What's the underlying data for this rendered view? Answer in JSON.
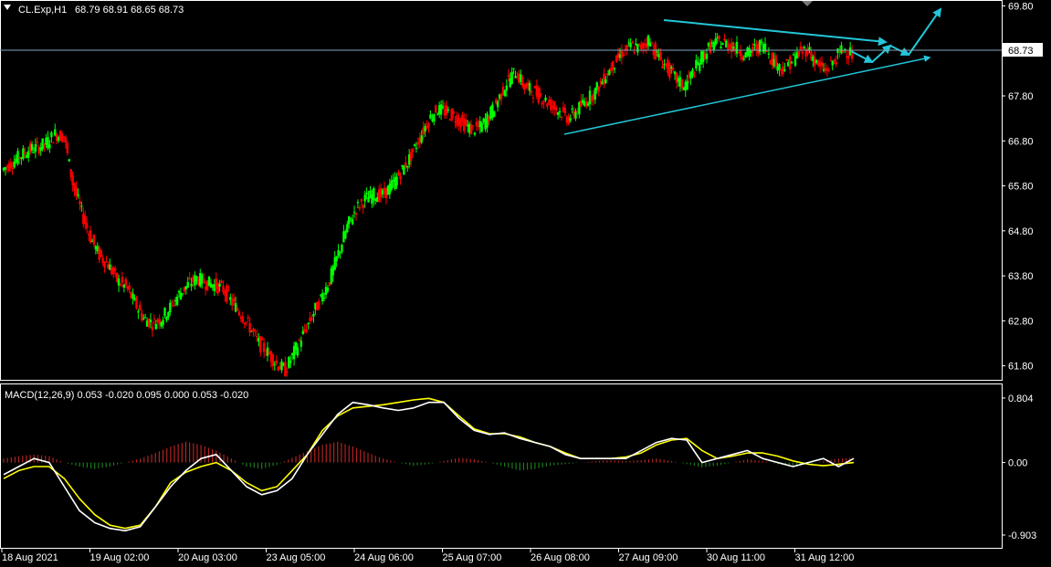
{
  "symbol_header": {
    "symbol": "CL.Exp,H1",
    "ohlc": "68.79 68.91 68.65 68.73"
  },
  "macd_header": "MACD(12,26,9) 0.053 -0.020 0.095 0.000 0.053 -0.020",
  "current_price": "68.73",
  "colors": {
    "background": "#000000",
    "bull": "#00ff00",
    "bear": "#ff0000",
    "trendline": "#22c7d9",
    "macd_line": "#ffffff",
    "signal_line": "#ffff00",
    "hist_pos": "#b22222",
    "hist_neg": "#1a7a1a",
    "grid_border": "#ffffff"
  },
  "chart_data": [
    {
      "type": "candlestick",
      "title": "CL.Exp,H1",
      "y_ticks": [
        "69.80",
        "68.73",
        "67.80",
        "66.80",
        "65.80",
        "64.80",
        "63.80",
        "62.80",
        "61.80"
      ],
      "ylim": [
        61.57,
        69.85
      ],
      "x_ticks": [
        "18 Aug 2021",
        "19 Aug 02:00",
        "20 Aug 03:00",
        "23 Aug 05:00",
        "24 Aug 06:00",
        "25 Aug 07:00",
        "26 Aug 08:00",
        "27 Aug 09:00",
        "30 Aug 11:00",
        "31 Aug 12:00"
      ],
      "closes": [
        66.15,
        66.3,
        66.45,
        66.6,
        66.65,
        66.75,
        66.95,
        66.9,
        65.85,
        65.2,
        64.65,
        64.25,
        64.05,
        63.7,
        63.55,
        63.2,
        62.85,
        62.75,
        62.85,
        63.1,
        63.4,
        63.6,
        63.75,
        63.65,
        63.6,
        63.5,
        63.2,
        62.95,
        62.65,
        62.3,
        62.1,
        61.85,
        61.7,
        62.1,
        62.5,
        62.9,
        63.3,
        63.7,
        64.3,
        64.9,
        65.3,
        65.5,
        65.6,
        65.6,
        65.8,
        66.1,
        66.4,
        66.8,
        67.2,
        67.5,
        67.45,
        67.35,
        67.2,
        67.05,
        67.1,
        67.35,
        67.7,
        68.1,
        68.35,
        68.0,
        67.9,
        67.75,
        67.6,
        67.45,
        67.3,
        67.5,
        67.7,
        67.9,
        68.2,
        68.5,
        68.75,
        68.9,
        68.85,
        69.05,
        68.7,
        68.45,
        68.2,
        68.0,
        68.3,
        68.65,
        68.9,
        69.0,
        68.95,
        68.85,
        68.7,
        68.85,
        68.95,
        68.6,
        68.4,
        68.55,
        68.75,
        68.85,
        68.5,
        68.35,
        68.6,
        68.85,
        68.73
      ],
      "opens": [
        66.05,
        66.15,
        66.3,
        66.45,
        66.6,
        66.65,
        66.75,
        66.95,
        66.9,
        65.85,
        65.2,
        64.65,
        64.25,
        64.05,
        63.7,
        63.55,
        63.2,
        62.85,
        62.75,
        62.85,
        63.1,
        63.4,
        63.6,
        63.75,
        63.65,
        63.6,
        63.5,
        63.2,
        62.95,
        62.65,
        62.3,
        62.1,
        61.85,
        61.7,
        62.1,
        62.5,
        62.9,
        63.3,
        63.7,
        64.3,
        64.9,
        65.3,
        65.5,
        65.6,
        65.6,
        65.8,
        66.1,
        66.4,
        66.8,
        67.2,
        67.5,
        67.45,
        67.35,
        67.2,
        67.05,
        67.1,
        67.35,
        67.7,
        68.1,
        68.35,
        68.0,
        67.9,
        67.75,
        67.6,
        67.45,
        67.3,
        67.5,
        67.7,
        67.9,
        68.2,
        68.5,
        68.75,
        68.9,
        68.85,
        69.05,
        68.7,
        68.45,
        68.2,
        68.0,
        68.3,
        68.65,
        68.9,
        69.0,
        68.95,
        68.85,
        68.7,
        68.85,
        68.95,
        68.6,
        68.4,
        68.55,
        68.75,
        68.85,
        68.5,
        68.35,
        68.6,
        68.79
      ]
    },
    {
      "type": "line",
      "title": "MACD(12,26,9)",
      "y_ticks": [
        "0.804",
        "0.00",
        "-0.903"
      ],
      "ylim": [
        -0.96,
        0.86
      ],
      "series": [
        {
          "name": "MACD",
          "values": [
            -0.15,
            -0.05,
            0.05,
            0.0,
            -0.3,
            -0.6,
            -0.75,
            -0.82,
            -0.85,
            -0.8,
            -0.55,
            -0.3,
            -0.1,
            0.05,
            0.1,
            -0.1,
            -0.3,
            -0.4,
            -0.35,
            -0.2,
            0.1,
            0.35,
            0.6,
            0.75,
            0.72,
            0.68,
            0.65,
            0.68,
            0.75,
            0.75,
            0.55,
            0.4,
            0.35,
            0.37,
            0.3,
            0.25,
            0.2,
            0.1,
            0.05,
            0.05,
            0.05,
            0.05,
            0.15,
            0.25,
            0.3,
            0.28,
            0.0,
            0.05,
            0.1,
            0.15,
            0.05,
            0.0,
            -0.05,
            0.0,
            0.05,
            -0.05,
            0.05
          ]
        },
        {
          "name": "Signal",
          "values": [
            -0.2,
            -0.1,
            -0.05,
            -0.05,
            -0.2,
            -0.45,
            -0.65,
            -0.78,
            -0.82,
            -0.78,
            -0.55,
            -0.25,
            -0.12,
            -0.05,
            0.0,
            -0.1,
            -0.25,
            -0.35,
            -0.3,
            -0.1,
            0.1,
            0.4,
            0.58,
            0.68,
            0.7,
            0.72,
            0.75,
            0.78,
            0.8,
            0.75,
            0.58,
            0.42,
            0.36,
            0.36,
            0.32,
            0.25,
            0.2,
            0.12,
            0.05,
            0.05,
            0.05,
            0.07,
            0.12,
            0.22,
            0.28,
            0.3,
            0.15,
            0.05,
            0.08,
            0.12,
            0.12,
            0.08,
            0.02,
            -0.02,
            -0.04,
            -0.02,
            0.0
          ]
        },
        {
          "name": "Histogram",
          "values": [
            0.05,
            0.08,
            0.1,
            0.08,
            0.0,
            -0.05,
            -0.08,
            -0.05,
            0.0,
            0.05,
            0.12,
            0.2,
            0.26,
            0.22,
            0.15,
            0.05,
            -0.05,
            -0.08,
            -0.03,
            0.06,
            0.14,
            0.22,
            0.26,
            0.2,
            0.12,
            0.05,
            0.0,
            -0.04,
            -0.02,
            0.02,
            0.06,
            0.04,
            0.0,
            -0.05,
            -0.1,
            -0.08,
            -0.04,
            -0.02,
            0.0,
            0.02,
            0.03,
            0.02,
            0.03,
            0.05,
            0.02,
            -0.02,
            -0.06,
            -0.04,
            0.0,
            0.04,
            0.02,
            -0.02,
            -0.04,
            -0.02,
            0.02,
            0.05,
            0.06
          ]
        }
      ]
    }
  ]
}
